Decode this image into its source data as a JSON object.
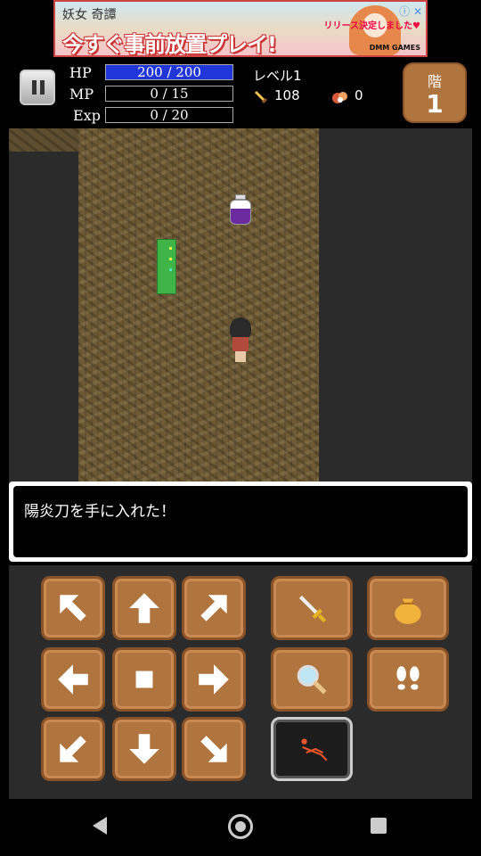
{
  "ad": {
    "top_text": "妖女 奇譚",
    "main_text": "今すぐ事前放置プレイ!",
    "right_text": "リリース決定しました♥",
    "brand": "DMM GAMES",
    "icons": "ⓘ ✕"
  },
  "hud": {
    "hp_label": "HP",
    "hp_value": "200 / 200",
    "hp_fraction": 1.0,
    "mp_label": "MP",
    "mp_value": "0 / 15",
    "mp_fraction": 0,
    "exp_label": "Exp",
    "exp_value": "0 / 20",
    "exp_fraction": 0,
    "level": "レベル1",
    "attack_value": "108",
    "gold_value": "0",
    "floor_label": "階",
    "floor_number": "1"
  },
  "message": {
    "text": "陽炎刀を手に入れた！"
  },
  "controls": {
    "move": [
      "up-left",
      "up",
      "up-right",
      "left",
      "wait",
      "right",
      "down-left",
      "down",
      "down-right"
    ],
    "actions": [
      "sword-icon",
      "bag-icon",
      "search-icon",
      "footprints-icon",
      "special-skill-icon"
    ]
  }
}
